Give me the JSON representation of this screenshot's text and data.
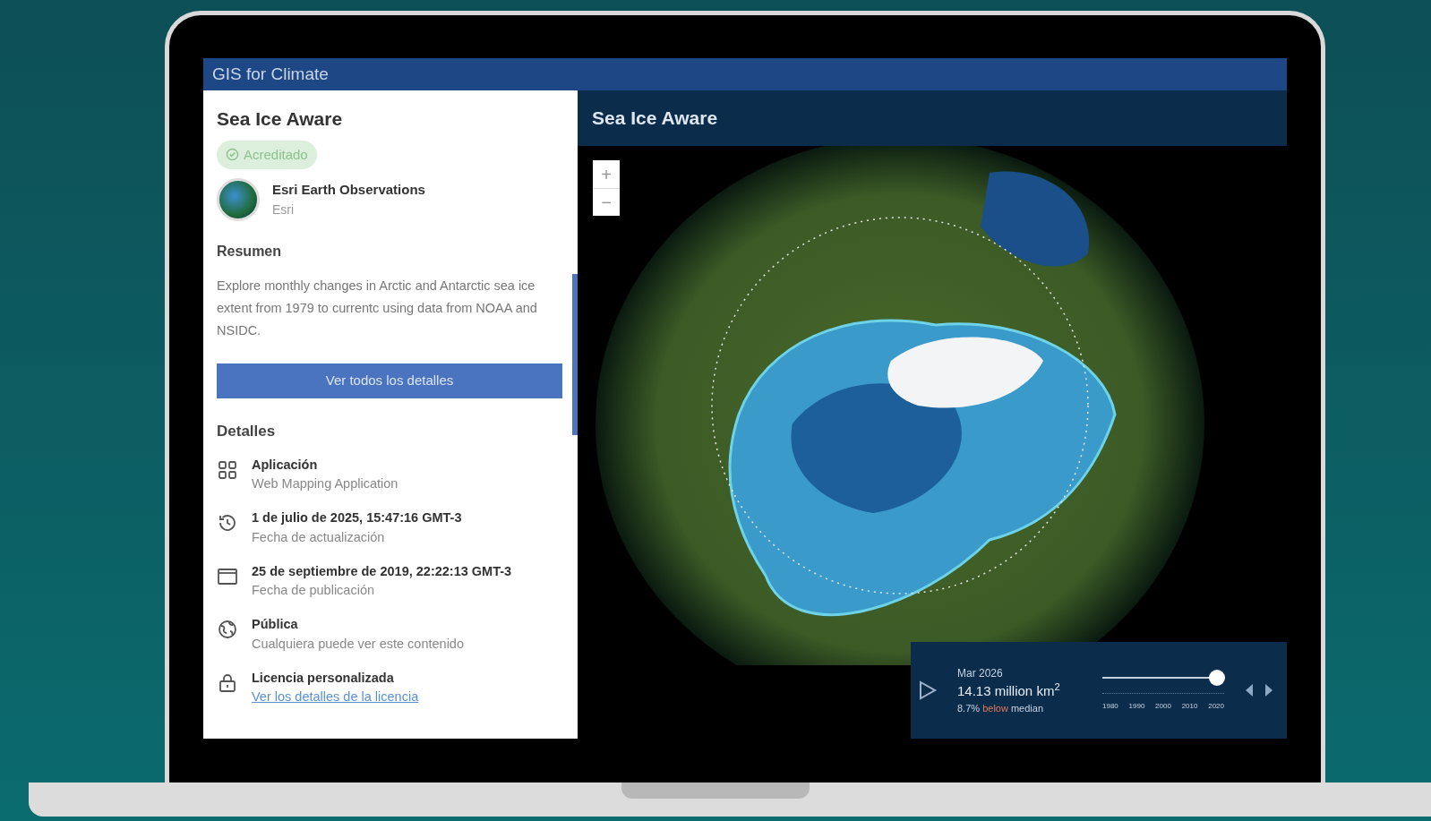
{
  "app_bar": {
    "title": "GIS for Climate"
  },
  "sidebar": {
    "title": "Sea Ice Aware",
    "badge": "Acreditado",
    "owner": {
      "name": "Esri Earth Observations",
      "org": "Esri"
    },
    "summary": {
      "heading": "Resumen",
      "text": "Explore monthly changes in Arctic and Antarctic sea ice extent from 1979 to currentc using data from NOAA and NSIDC."
    },
    "details_button": "Ver todos los detalles",
    "details": {
      "heading": "Detalles",
      "items": [
        {
          "kind": "app",
          "title": "Aplicación",
          "subtitle": "Web Mapping Application"
        },
        {
          "kind": "updated",
          "title": "1 de julio de 2025, 15:47:16 GMT-3",
          "subtitle": "Fecha de actualización"
        },
        {
          "kind": "published",
          "title": "25 de septiembre de 2019, 22:22:13 GMT-3",
          "subtitle": "Fecha de publicación"
        },
        {
          "kind": "public",
          "title": "Pública",
          "subtitle": "Cualquiera puede ver este contenido"
        },
        {
          "kind": "license",
          "title": "Licencia personalizada",
          "link": "Ver los detalles de la licencia"
        }
      ]
    }
  },
  "map": {
    "header": "Sea Ice Aware",
    "zoom_in": "+",
    "zoom_out": "−",
    "time_panel": {
      "date": "Mar 2026",
      "extent": "14.13 million km$^{2}$",
      "percent": "8.7%",
      "comparison": "below",
      "suffix": "median",
      "level": 0.94,
      "years": [
        "1980",
        "1990",
        "2000",
        "2010",
        "2020"
      ]
    }
  }
}
